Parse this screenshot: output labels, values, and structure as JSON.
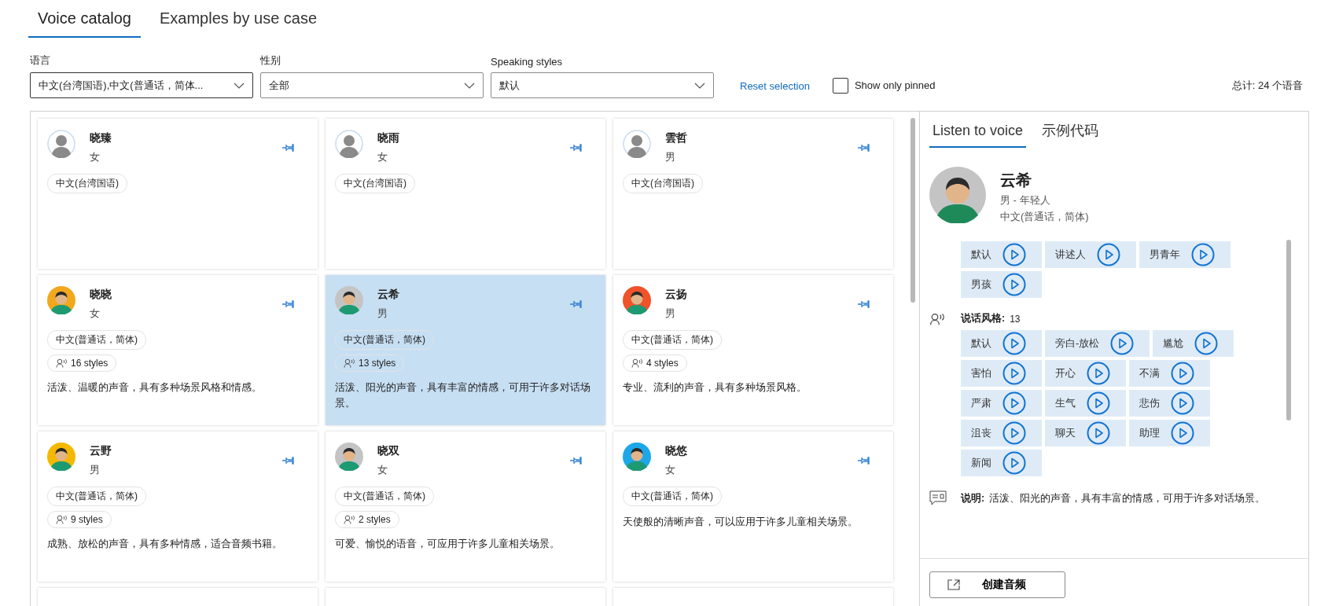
{
  "tabs": [
    {
      "label": "Voice catalog",
      "selected": true
    },
    {
      "label": "Examples by use case",
      "selected": false
    }
  ],
  "filters": [
    {
      "label": "语言",
      "value": "中文(台湾国语),中文(普通话，简体..."
    },
    {
      "label": "性别",
      "value": "全部"
    },
    {
      "label": "Speaking styles",
      "value": "默认"
    }
  ],
  "reset_link": "Reset selection",
  "pinned_filter": {
    "label": "Show only pinned",
    "checked": false
  },
  "total": "总计: 24 个语音",
  "voices": [
    {
      "name": "晓臻",
      "gender": "女",
      "locale": "中文(台湾国语)",
      "kind": "placeholder",
      "selected": false
    },
    {
      "name": "晓雨",
      "gender": "女",
      "locale": "中文(台湾国语)",
      "kind": "placeholder",
      "selected": false
    },
    {
      "name": "雲哲",
      "gender": "男",
      "locale": "中文(台湾国语)",
      "kind": "placeholder",
      "selected": false
    },
    {
      "name": "晓晓",
      "gender": "女",
      "locale": "中文(普通话，简体)",
      "styles": "16 styles",
      "description": "活泼、温暖的声音，具有多种场景风格和情感。",
      "kind": "character",
      "color": "#f2a81d",
      "selected": false
    },
    {
      "name": "云希",
      "gender": "男",
      "locale": "中文(普通话，简体)",
      "styles": "13 styles",
      "description": "活泼、阳光的声音，具有丰富的情感，可用于许多对话场景。",
      "kind": "character",
      "color": "#c4c4c4",
      "selected": true
    },
    {
      "name": "云扬",
      "gender": "男",
      "locale": "中文(普通话，简体)",
      "styles": "4 styles",
      "description": "专业、流利的声音，具有多种场景风格。",
      "kind": "character",
      "color": "#f0522a",
      "selected": false
    },
    {
      "name": "云野",
      "gender": "男",
      "locale": "中文(普通话，简体)",
      "styles": "9 styles",
      "description": "成熟、放松的声音，具有多种情感，适合音频书籍。",
      "kind": "character",
      "color": "#f5b800",
      "selected": false
    },
    {
      "name": "晓双",
      "gender": "女",
      "locale": "中文(普通话，简体)",
      "styles": "2 styles",
      "description": "可爱、愉悦的语音，可应用于许多儿童相关场景。",
      "kind": "character",
      "color": "#c4c4c4",
      "selected": false
    },
    {
      "name": "晓悠",
      "gender": "女",
      "locale": "中文(普通话，简体)",
      "description": "天使般的清晰声音，可以应用于许多儿童相关场景。",
      "kind": "character",
      "color": "#1ea7e8",
      "selected": false
    }
  ],
  "detail": {
    "tabs": [
      {
        "label": "Listen to voice",
        "selected": true
      },
      {
        "label": "示例代码",
        "selected": false
      }
    ],
    "name": "云希",
    "info": "男 - 年轻人",
    "locale": "中文(普通话，简体)",
    "roles": [
      "默认",
      "讲述人",
      "男青年",
      "男孩"
    ],
    "styles_label": "说话风格:",
    "styles_count": "13",
    "styles": [
      "默认",
      "旁白-放松",
      "尴尬",
      "害怕",
      "开心",
      "不满",
      "严肃",
      "生气",
      "悲伤",
      "沮丧",
      "聊天",
      "助理",
      "新闻"
    ],
    "description_label": "说明:",
    "description": "活泼、阳光的声音，具有丰富的情感，可用于许多对话场景。",
    "create_button": "创建音频"
  }
}
